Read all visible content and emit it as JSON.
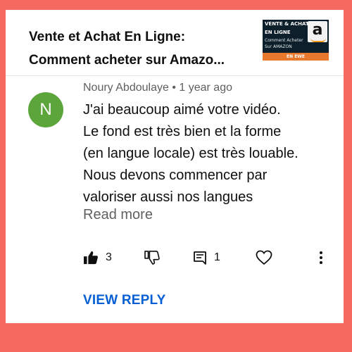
{
  "video": {
    "title_line1": "Vente et Achat En Ligne:",
    "title_line2": "Comment acheter sur Amazo...",
    "thumbnail": {
      "line1": "VENTE & ACHAT",
      "line2": "EN LIGNE",
      "line3": "Comment Acheter",
      "line4": "Sur AMAZON",
      "bar": "EN EWE",
      "logo_letter": "a"
    }
  },
  "comment": {
    "avatar_letter": "N",
    "avatar_color": "#5ba53a",
    "author": "Noury Abdoulaye",
    "separator": "•",
    "time": "1 year ago",
    "lines": [
      "J'ai beaucoup aimé votre vidéo.",
      "Le fond est très bien et la forme",
      "(en langue locale) est très louable.",
      "Nous devons commencer par",
      "valoriser aussi nos langues"
    ],
    "read_more": "Read more",
    "likes": "3",
    "replies": "1",
    "view_reply": "VIEW REPLY"
  },
  "icons": {
    "like": "thumbs-up-icon",
    "dislike": "thumbs-down-icon",
    "reply": "reply-comment-icon",
    "heart": "heart-icon",
    "more": "more-vert-icon"
  },
  "colors": {
    "background": "#f46a60",
    "link": "#065fd4",
    "secondary_text": "#606060"
  }
}
